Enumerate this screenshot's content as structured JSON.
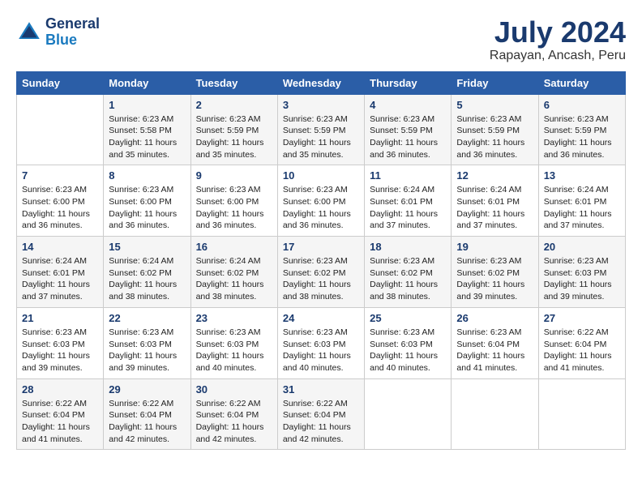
{
  "logo": {
    "line1": "General",
    "line2": "Blue"
  },
  "title": "July 2024",
  "location": "Rapayan, Ancash, Peru",
  "days_of_week": [
    "Sunday",
    "Monday",
    "Tuesday",
    "Wednesday",
    "Thursday",
    "Friday",
    "Saturday"
  ],
  "weeks": [
    [
      {
        "day": "",
        "sunrise": "",
        "sunset": "",
        "daylight": ""
      },
      {
        "day": "1",
        "sunrise": "Sunrise: 6:23 AM",
        "sunset": "Sunset: 5:58 PM",
        "daylight": "Daylight: 11 hours and 35 minutes."
      },
      {
        "day": "2",
        "sunrise": "Sunrise: 6:23 AM",
        "sunset": "Sunset: 5:59 PM",
        "daylight": "Daylight: 11 hours and 35 minutes."
      },
      {
        "day": "3",
        "sunrise": "Sunrise: 6:23 AM",
        "sunset": "Sunset: 5:59 PM",
        "daylight": "Daylight: 11 hours and 35 minutes."
      },
      {
        "day": "4",
        "sunrise": "Sunrise: 6:23 AM",
        "sunset": "Sunset: 5:59 PM",
        "daylight": "Daylight: 11 hours and 36 minutes."
      },
      {
        "day": "5",
        "sunrise": "Sunrise: 6:23 AM",
        "sunset": "Sunset: 5:59 PM",
        "daylight": "Daylight: 11 hours and 36 minutes."
      },
      {
        "day": "6",
        "sunrise": "Sunrise: 6:23 AM",
        "sunset": "Sunset: 5:59 PM",
        "daylight": "Daylight: 11 hours and 36 minutes."
      }
    ],
    [
      {
        "day": "7",
        "sunrise": "Sunrise: 6:23 AM",
        "sunset": "Sunset: 6:00 PM",
        "daylight": "Daylight: 11 hours and 36 minutes."
      },
      {
        "day": "8",
        "sunrise": "Sunrise: 6:23 AM",
        "sunset": "Sunset: 6:00 PM",
        "daylight": "Daylight: 11 hours and 36 minutes."
      },
      {
        "day": "9",
        "sunrise": "Sunrise: 6:23 AM",
        "sunset": "Sunset: 6:00 PM",
        "daylight": "Daylight: 11 hours and 36 minutes."
      },
      {
        "day": "10",
        "sunrise": "Sunrise: 6:23 AM",
        "sunset": "Sunset: 6:00 PM",
        "daylight": "Daylight: 11 hours and 36 minutes."
      },
      {
        "day": "11",
        "sunrise": "Sunrise: 6:24 AM",
        "sunset": "Sunset: 6:01 PM",
        "daylight": "Daylight: 11 hours and 37 minutes."
      },
      {
        "day": "12",
        "sunrise": "Sunrise: 6:24 AM",
        "sunset": "Sunset: 6:01 PM",
        "daylight": "Daylight: 11 hours and 37 minutes."
      },
      {
        "day": "13",
        "sunrise": "Sunrise: 6:24 AM",
        "sunset": "Sunset: 6:01 PM",
        "daylight": "Daylight: 11 hours and 37 minutes."
      }
    ],
    [
      {
        "day": "14",
        "sunrise": "Sunrise: 6:24 AM",
        "sunset": "Sunset: 6:01 PM",
        "daylight": "Daylight: 11 hours and 37 minutes."
      },
      {
        "day": "15",
        "sunrise": "Sunrise: 6:24 AM",
        "sunset": "Sunset: 6:02 PM",
        "daylight": "Daylight: 11 hours and 38 minutes."
      },
      {
        "day": "16",
        "sunrise": "Sunrise: 6:24 AM",
        "sunset": "Sunset: 6:02 PM",
        "daylight": "Daylight: 11 hours and 38 minutes."
      },
      {
        "day": "17",
        "sunrise": "Sunrise: 6:23 AM",
        "sunset": "Sunset: 6:02 PM",
        "daylight": "Daylight: 11 hours and 38 minutes."
      },
      {
        "day": "18",
        "sunrise": "Sunrise: 6:23 AM",
        "sunset": "Sunset: 6:02 PM",
        "daylight": "Daylight: 11 hours and 38 minutes."
      },
      {
        "day": "19",
        "sunrise": "Sunrise: 6:23 AM",
        "sunset": "Sunset: 6:02 PM",
        "daylight": "Daylight: 11 hours and 39 minutes."
      },
      {
        "day": "20",
        "sunrise": "Sunrise: 6:23 AM",
        "sunset": "Sunset: 6:03 PM",
        "daylight": "Daylight: 11 hours and 39 minutes."
      }
    ],
    [
      {
        "day": "21",
        "sunrise": "Sunrise: 6:23 AM",
        "sunset": "Sunset: 6:03 PM",
        "daylight": "Daylight: 11 hours and 39 minutes."
      },
      {
        "day": "22",
        "sunrise": "Sunrise: 6:23 AM",
        "sunset": "Sunset: 6:03 PM",
        "daylight": "Daylight: 11 hours and 39 minutes."
      },
      {
        "day": "23",
        "sunrise": "Sunrise: 6:23 AM",
        "sunset": "Sunset: 6:03 PM",
        "daylight": "Daylight: 11 hours and 40 minutes."
      },
      {
        "day": "24",
        "sunrise": "Sunrise: 6:23 AM",
        "sunset": "Sunset: 6:03 PM",
        "daylight": "Daylight: 11 hours and 40 minutes."
      },
      {
        "day": "25",
        "sunrise": "Sunrise: 6:23 AM",
        "sunset": "Sunset: 6:03 PM",
        "daylight": "Daylight: 11 hours and 40 minutes."
      },
      {
        "day": "26",
        "sunrise": "Sunrise: 6:23 AM",
        "sunset": "Sunset: 6:04 PM",
        "daylight": "Daylight: 11 hours and 41 minutes."
      },
      {
        "day": "27",
        "sunrise": "Sunrise: 6:22 AM",
        "sunset": "Sunset: 6:04 PM",
        "daylight": "Daylight: 11 hours and 41 minutes."
      }
    ],
    [
      {
        "day": "28",
        "sunrise": "Sunrise: 6:22 AM",
        "sunset": "Sunset: 6:04 PM",
        "daylight": "Daylight: 11 hours and 41 minutes."
      },
      {
        "day": "29",
        "sunrise": "Sunrise: 6:22 AM",
        "sunset": "Sunset: 6:04 PM",
        "daylight": "Daylight: 11 hours and 42 minutes."
      },
      {
        "day": "30",
        "sunrise": "Sunrise: 6:22 AM",
        "sunset": "Sunset: 6:04 PM",
        "daylight": "Daylight: 11 hours and 42 minutes."
      },
      {
        "day": "31",
        "sunrise": "Sunrise: 6:22 AM",
        "sunset": "Sunset: 6:04 PM",
        "daylight": "Daylight: 11 hours and 42 minutes."
      },
      {
        "day": "",
        "sunrise": "",
        "sunset": "",
        "daylight": ""
      },
      {
        "day": "",
        "sunrise": "",
        "sunset": "",
        "daylight": ""
      },
      {
        "day": "",
        "sunrise": "",
        "sunset": "",
        "daylight": ""
      }
    ]
  ]
}
